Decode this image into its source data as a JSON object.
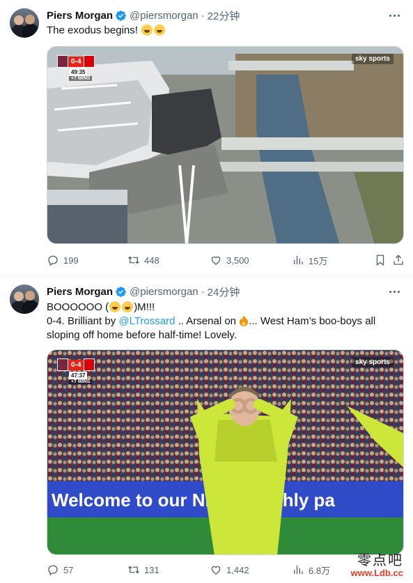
{
  "tweets": [
    {
      "name": "Piers Morgan",
      "handle": "@piersmorgan",
      "separator": "·",
      "time": "22分钟",
      "text": "The exodus begins! ",
      "media": {
        "scorebug": {
          "score": "0-4",
          "clock": "49:35",
          "added": "+7 MINS"
        },
        "broadcaster": "sky sports"
      },
      "stats": {
        "replies": "199",
        "reposts": "448",
        "likes": "3,500",
        "views": "15万"
      }
    },
    {
      "name": "Piers Morgan",
      "handle": "@piersmorgan",
      "separator": "·",
      "time": "24分钟",
      "line1_a": "BOOOOOO (",
      "line1_b": ")M!!!",
      "line2_a": "0-4. Brilliant by ",
      "mention": "@LTrossard",
      "line2_b": " .. Arsenal on ",
      "line2_c": "... West Ham’s boo-boys all",
      "line3": "sloping off home before half-time! Lovely.",
      "media": {
        "scorebug": {
          "score": "0-4",
          "clock": "47:37",
          "added": "+7 MINS"
        },
        "broadcaster": "sky sports",
        "banner": "Welcome to our NEW Monthly pa"
      },
      "stats": {
        "replies": "57",
        "reposts": "131",
        "likes": "1,442",
        "views": "6.8万"
      }
    }
  ],
  "watermark": {
    "cn": "零点吧",
    "url": "www.Ldb.cc"
  },
  "colors": {
    "accent": "#1d9bf0",
    "muted": "#536471",
    "arsenal_kit": "#d4f23b"
  },
  "icons": [
    "verified-badge-icon",
    "more-icon",
    "reply-icon",
    "repost-icon",
    "like-icon",
    "views-icon",
    "bookmark-icon",
    "share-icon"
  ]
}
